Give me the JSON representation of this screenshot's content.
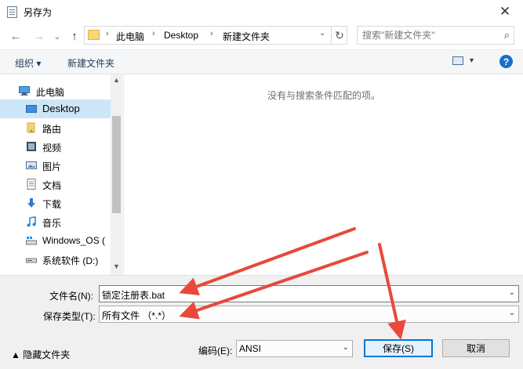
{
  "window": {
    "title": "另存为",
    "close_glyph": "✕"
  },
  "nav": {
    "back": "←",
    "forward": "→",
    "history": "⌄",
    "up": "↑"
  },
  "address": {
    "segments": [
      "此电脑",
      "Desktop",
      "新建文件夹"
    ],
    "separator": "›",
    "dropdown": "⌄",
    "refresh": "↻"
  },
  "search": {
    "placeholder": "搜索\"新建文件夹\"",
    "icon": "⌕"
  },
  "toolbar": {
    "organize": "组织 ▾",
    "new_folder": "新建文件夹",
    "view_dd": "▾",
    "help": "?"
  },
  "sidebar": {
    "items": [
      {
        "label": "此电脑",
        "icon": "computer-icon"
      },
      {
        "label": "Desktop",
        "icon": "desktop-icon",
        "selected": true
      },
      {
        "label": "路由",
        "icon": "folder-icon"
      },
      {
        "label": "视频",
        "icon": "video-icon"
      },
      {
        "label": "图片",
        "icon": "pictures-icon"
      },
      {
        "label": "文档",
        "icon": "documents-icon"
      },
      {
        "label": "下载",
        "icon": "download-icon"
      },
      {
        "label": "音乐",
        "icon": "music-icon"
      },
      {
        "label": "Windows_OS (",
        "icon": "drive-icon"
      },
      {
        "label": "系统软件 (D:)",
        "icon": "drive-icon"
      }
    ],
    "scroll_up": "▲",
    "scroll_down": "▼"
  },
  "content": {
    "empty_message": "没有与搜索条件匹配的项。"
  },
  "form": {
    "filename_label": "文件名(N):",
    "filename_value": "锁定注册表.bat",
    "filetype_label": "保存类型(T):",
    "filetype_value": "所有文件 （*.*）",
    "dropdown_arrow": "⌄",
    "encoding_label": "编码(E):",
    "encoding_value": "ANSI",
    "save": "保存(S)",
    "cancel": "取消",
    "hide_folders": "▲  隐藏文件夹"
  },
  "colors": {
    "annotation_arrow": "#e8493b",
    "selection": "#cde6f7",
    "default_button_border": "#0078d7"
  }
}
